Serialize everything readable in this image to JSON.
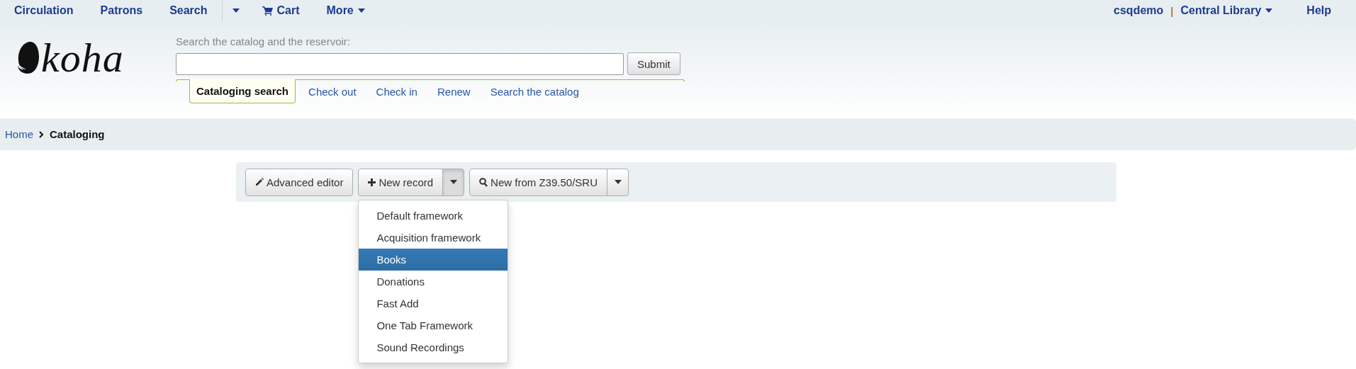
{
  "top_nav": {
    "left": [
      {
        "kind": "link",
        "label": "Circulation"
      },
      {
        "kind": "link",
        "label": "Patrons"
      },
      {
        "kind": "link",
        "label": "Search"
      },
      {
        "kind": "caret"
      },
      {
        "kind": "cart",
        "label": "Cart"
      },
      {
        "kind": "dropdown",
        "label": "More"
      }
    ],
    "user": "csqdemo",
    "separator": "|",
    "library": "Central Library",
    "help": "Help"
  },
  "header": {
    "logo": "koha",
    "search_label": "Search the catalog and the reservoir:",
    "submit": "Submit",
    "tabs": [
      {
        "label": "Cataloging search",
        "selected": true
      },
      {
        "label": "Check out",
        "selected": false
      },
      {
        "label": "Check in",
        "selected": false
      },
      {
        "label": "Renew",
        "selected": false
      },
      {
        "label": "Search the catalog",
        "selected": false
      }
    ]
  },
  "breadcrumb": [
    {
      "label": "Home",
      "current": false
    },
    {
      "label": "Cataloging",
      "current": true
    }
  ],
  "toolbar": {
    "buttons": [
      {
        "kind": "button",
        "label": "Advanced editor"
      },
      {
        "kind": "split",
        "label": "New record",
        "expanded": true
      },
      {
        "kind": "split",
        "label": "New from Z39.50/SRU",
        "expanded": false
      }
    ],
    "menu": [
      {
        "label": "Default framework",
        "selected": false
      },
      {
        "label": "Acquisition framework",
        "selected": false
      },
      {
        "label": "Books",
        "selected": true
      },
      {
        "label": "Donations",
        "selected": false
      },
      {
        "label": "Fast Add",
        "selected": false
      },
      {
        "label": "One Tab Framework",
        "selected": false
      },
      {
        "label": "Sound Recordings",
        "selected": false
      }
    ]
  }
}
